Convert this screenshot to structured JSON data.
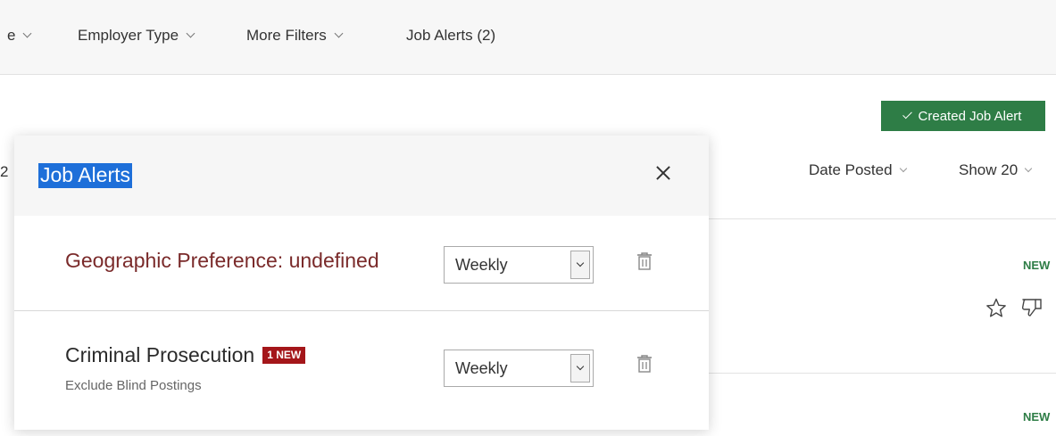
{
  "filters": [
    {
      "label": "e"
    },
    {
      "label": "Employer Type"
    },
    {
      "label": "More Filters"
    }
  ],
  "job_alerts_tab": "Job Alerts (2)",
  "created_button": "Created Job Alert",
  "sort": {
    "date_posted": "Date Posted",
    "show": "Show 20"
  },
  "results_count_peek": "2",
  "listing_tags": [
    "NEW",
    "NEW"
  ],
  "modal": {
    "title": "Job Alerts",
    "alerts": [
      {
        "name": "Geographic Preference: undefined",
        "frequency": "Weekly",
        "name_color": "#7a2a2a"
      },
      {
        "name": "Criminal Prosecution",
        "badge": "1 NEW",
        "sub": "Exclude Blind Postings",
        "frequency": "Weekly",
        "name_color": "#2b2b2b"
      }
    ]
  },
  "colors": {
    "accent_green": "#2e7d46",
    "badge_red": "#a4161a",
    "highlight_blue": "#1e6fd9"
  },
  "icons": [
    "chevron-down-icon",
    "check-icon",
    "close-icon",
    "trash-icon",
    "star-icon",
    "thumbs-down-icon"
  ]
}
